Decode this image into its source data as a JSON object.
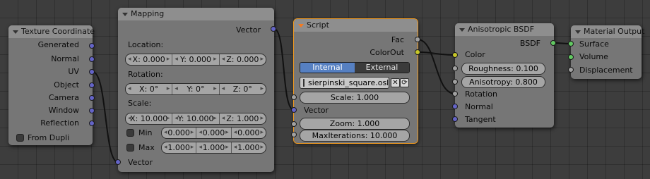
{
  "colors": {
    "vector_socket": "#6464c7",
    "float_socket": "#a1a1a1",
    "color_socket": "#c7c729",
    "shader_socket": "#62c862",
    "active_outline": "#f39b1f"
  },
  "texture_coordinate": {
    "title": "Texture Coordinate",
    "outputs": [
      "Generated",
      "Normal",
      "UV",
      "Object",
      "Camera",
      "Window",
      "Reflection"
    ],
    "from_dupli_label": "From Dupli"
  },
  "mapping": {
    "title": "Mapping",
    "output_label": "Vector",
    "location_label": "Location:",
    "location": [
      "X: 0.000",
      "Y: 0.000",
      "Z: 0.000"
    ],
    "rotation_label": "Rotation:",
    "rotation": [
      "X: 0°",
      "Y: 0°",
      "Z: 0°"
    ],
    "scale_label": "Scale:",
    "scale": [
      "X: 10.000",
      "Y: 10.000",
      "Z: 1.000"
    ],
    "min_label": "Min",
    "min": [
      "0.000",
      "0.000",
      "0.000"
    ],
    "max_label": "Max",
    "max": [
      "1.000",
      "1.000",
      "1.000"
    ],
    "input_label": "Vector"
  },
  "script": {
    "title": "Script",
    "outputs": [
      "Fac",
      "ColorOut"
    ],
    "mode_internal": "Internal",
    "mode_external": "External",
    "filename": "sierpinski_square.osl",
    "scale_field": "Scale: 1.000",
    "vector_label": "Vector",
    "zoom_field": "Zoom: 1.000",
    "max_iterations_field": "MaxIterations: 10.000"
  },
  "aniso": {
    "title": "Anisotropic BSDF",
    "output_label": "BSDF",
    "color_label": "Color",
    "roughness_field": "Roughness: 0.100",
    "anisotropy_field": "Anisotropy: 0.800",
    "rotation_label": "Rotation",
    "normal_label": "Normal",
    "tangent_label": "Tangent"
  },
  "material_output": {
    "title": "Material Output",
    "inputs": [
      "Surface",
      "Volume",
      "Displacement"
    ]
  }
}
